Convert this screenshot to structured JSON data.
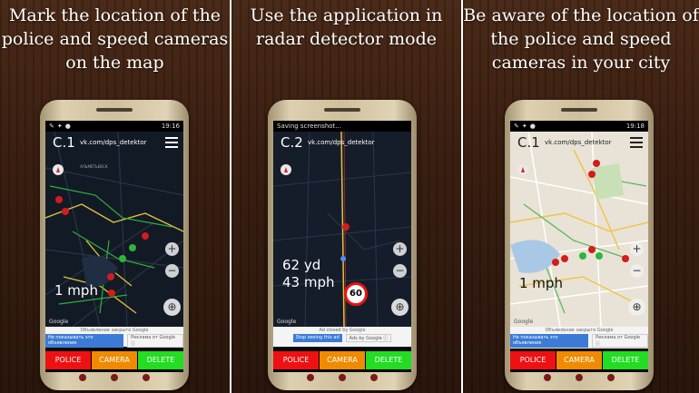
{
  "colors": {
    "police": "#ee1111",
    "camera": "#f08a00",
    "delete": "#22dd22",
    "map_dark": "#0f1622",
    "road_yellow": "#e3c33a",
    "road_green": "#2fae3a"
  },
  "panels": [
    {
      "caption": "Mark the location of the police and speed cameras on the map",
      "status": {
        "time": "19:16"
      },
      "mode_code": "C.1",
      "url": "vk.com/dps_detektor",
      "speed_line1": "",
      "speed_line2": "1 mph",
      "speed_limit": "",
      "map_style": "dark",
      "map_label": "АЛЬМЕТЬЕВСК",
      "google": "Google",
      "ad": {
        "top": "Объявление закрыто Google",
        "btn1": "Не показывать это объявление",
        "btn2": "Реклама от Google ⓘ"
      },
      "buttons": {
        "police": "POLICE",
        "camera": "CAMERA",
        "delete": "DELETE"
      },
      "icons": [
        "compass-icon",
        "zoom-in-icon",
        "zoom-out-icon",
        "my-location-icon",
        "menu-icon"
      ]
    },
    {
      "caption": "Use the application in radar detector mode",
      "status": {
        "time": "",
        "notice": "Saving screenshot..."
      },
      "mode_code": "C.2",
      "url": "vk.com/dps_detektor",
      "speed_line1": "62 yd",
      "speed_line2": "43 mph",
      "speed_limit": "60",
      "map_style": "dark",
      "map_label": "",
      "google": "Google",
      "ad": {
        "top": "Ad closed by Google",
        "btn1": "Stop seeing this ad",
        "btn2": "Ads by Google ⓘ"
      },
      "buttons": {
        "police": "POLICE",
        "camera": "CAMERA",
        "delete": "DELETE"
      },
      "icons": [
        "compass-icon",
        "zoom-in-icon",
        "zoom-out-icon",
        "my-location-icon",
        "speed-limit-sign-icon"
      ]
    },
    {
      "caption": "Be aware of the location of the police and speed cameras in your city",
      "status": {
        "time": "19:18"
      },
      "mode_code": "C.1",
      "url": "vk.com/dps_detektor",
      "speed_line1": "",
      "speed_line2": "1 mph",
      "speed_limit": "",
      "map_style": "light",
      "map_label": "",
      "google": "Google",
      "ad": {
        "top": "Объявление закрыто Google",
        "btn1": "Не показывать это объявление",
        "btn2": "Реклама от Google ⓘ"
      },
      "buttons": {
        "police": "POLICE",
        "camera": "CAMERA",
        "delete": "DELETE"
      },
      "icons": [
        "compass-icon",
        "zoom-in-icon",
        "zoom-out-icon",
        "my-location-icon",
        "menu-icon"
      ]
    }
  ]
}
